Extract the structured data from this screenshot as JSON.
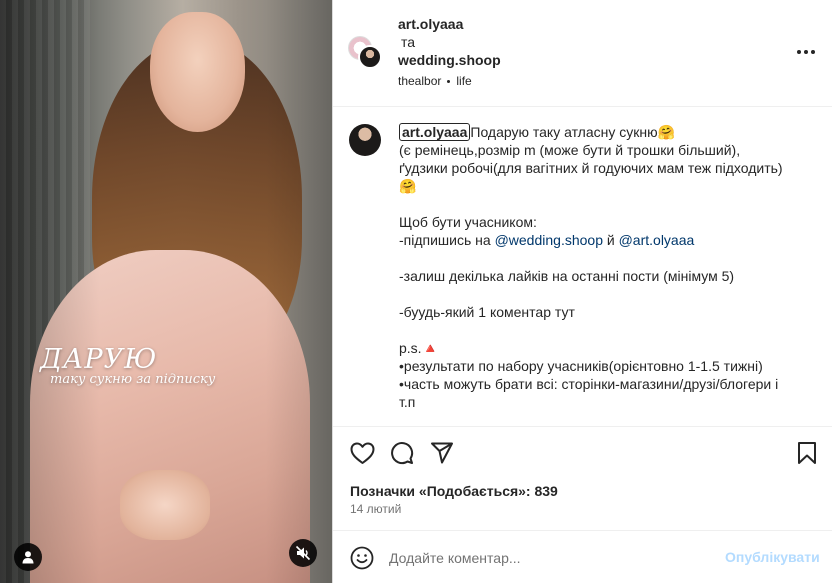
{
  "media": {
    "overlay_title": "ДАРУЮ",
    "overlay_subtitle": "таку сукню за підписку",
    "tag_icon": "user-icon",
    "mute_icon": "muted-speaker-icon"
  },
  "header": {
    "user1": "art.olyaaa",
    "conjunction": "та",
    "user2": "wedding.shoop",
    "audio": "thealbor",
    "location": "life",
    "more_icon": "more-dots-icon"
  },
  "caption": {
    "username": "art.olyaaa",
    "line1": "Подарую таку атласну сукню🤗",
    "line2": "(є ремінець,розмір m (може бути й трошки більший),",
    "line3": "ґудзики робочі(для вагітних й годуючих мам теж підходить)",
    "line4": "🤗",
    "line5": "",
    "line6": "Щоб бути учасником:",
    "line7_prefix": "-підпишись на ",
    "mention1": "@wedding.shoop",
    "line7_mid": " й ",
    "mention2": "@art.olyaaa",
    "line8": "",
    "line9": "-залиш декілька лайків на останні пости (мінімум 5)",
    "line10": "",
    "line11": "-буудь-який 1 коментар тут",
    "line12": "",
    "line13": "p.s.🔺",
    "line14": "•результати по набору учасників(орієнтовно 1-1.5 тижні)",
    "line15": "•часть можуть брати всі: сторінки-магазини/друзі/блогери і",
    "line16": "т.п"
  },
  "actions": {
    "like_icon": "heart-icon",
    "comment_icon": "comment-bubble-icon",
    "share_icon": "paper-plane-icon",
    "save_icon": "bookmark-icon"
  },
  "likes_text": "Позначки «Подобається»: 839",
  "date_text": "14 лютий",
  "add_comment": {
    "placeholder": "Додайте коментар...",
    "post_label": "Опублікувати",
    "emoji_icon": "smiley-icon"
  }
}
